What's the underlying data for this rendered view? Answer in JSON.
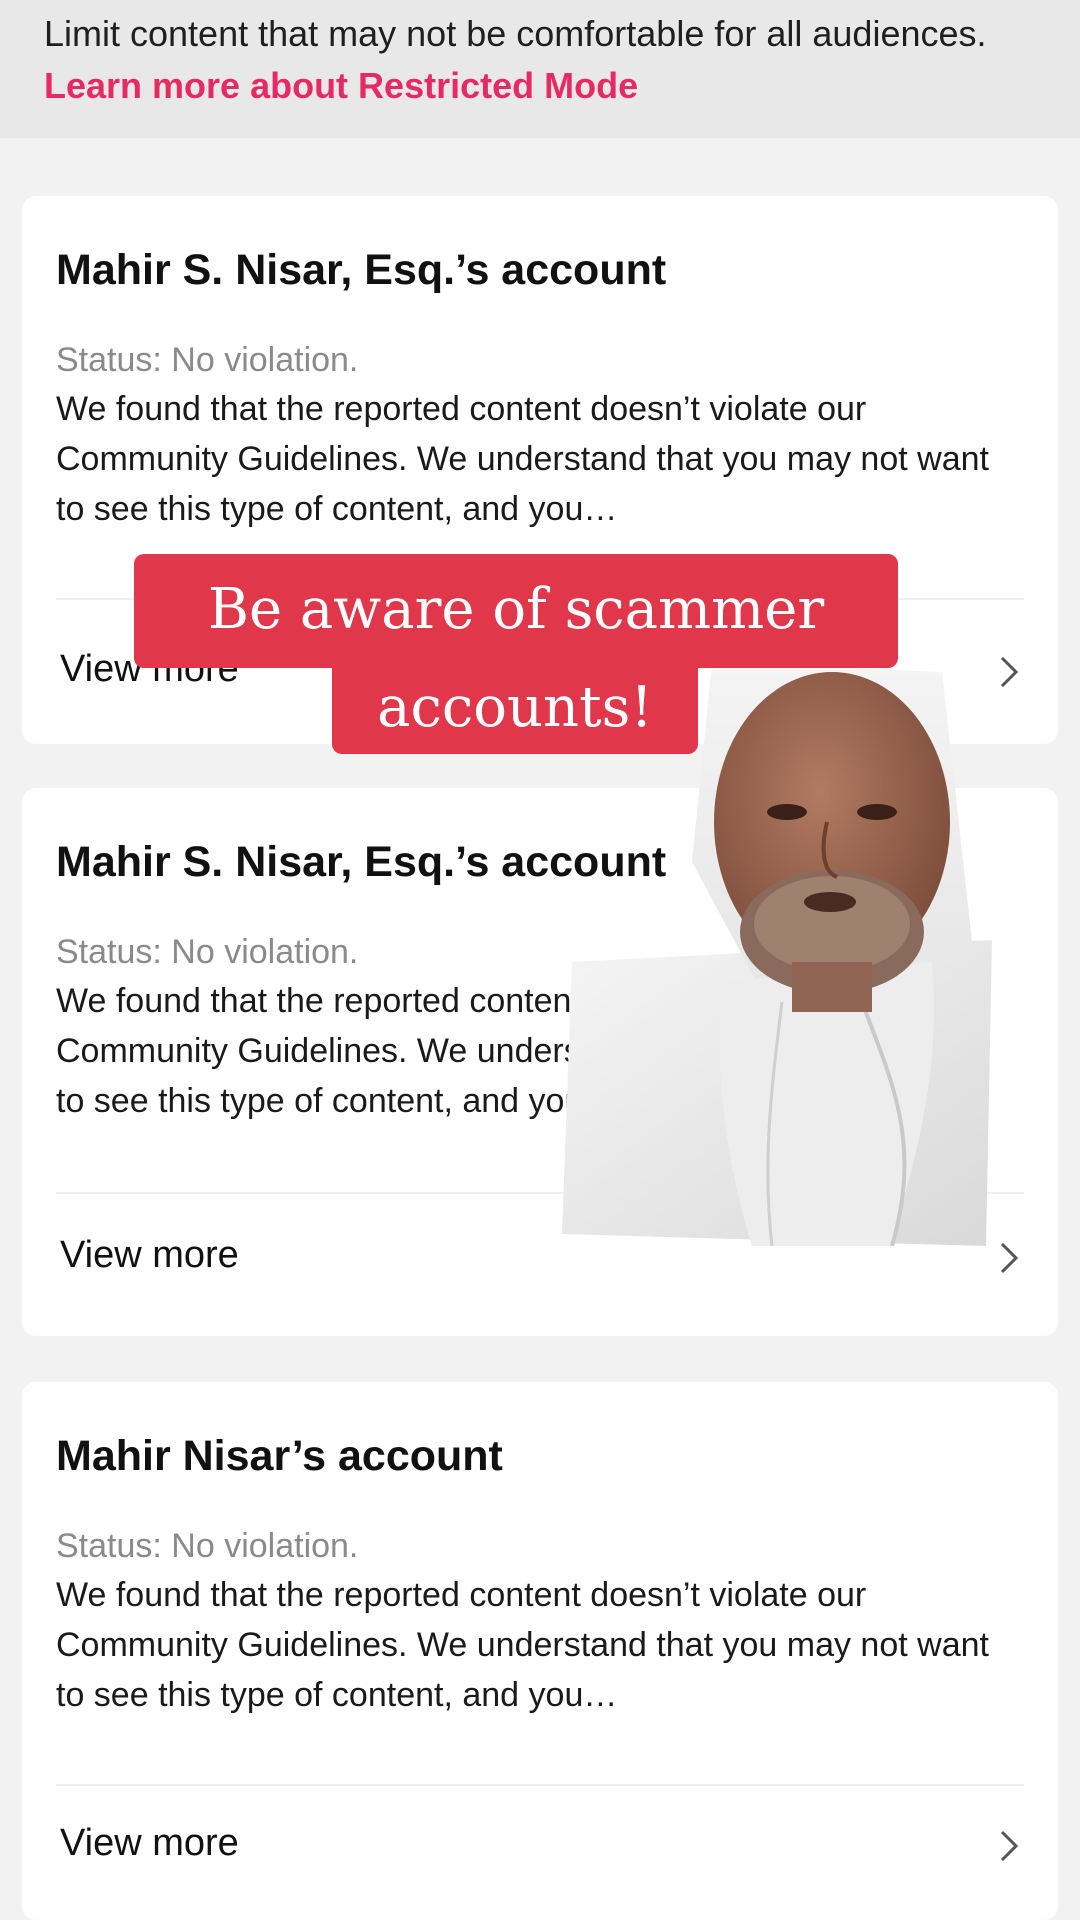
{
  "banner": {
    "text": "Limit content that may not be comfortable for all audiences.",
    "link_label": "Learn more about Restricted Mode"
  },
  "cards": [
    {
      "title": "Mahir S. Nisar, Esq.’s account",
      "status": "Status: No violation.",
      "body": "We found that the reported content doesn’t violate our Community Guidelines. We understand that you may not want to see this type of content, and you…",
      "action_label": "View more"
    },
    {
      "title": "Mahir S. Nisar, Esq.’s account",
      "status": "Status: No violation.",
      "body": "We found that the reported content doesn’t violate our Community Guidelines. We understand that you may not want to see this type of content, and you…",
      "action_label": "View more"
    },
    {
      "title": "Mahir Nisar’s account",
      "status": "Status: No violation.",
      "body": "We found that the reported content doesn’t violate our Community Guidelines. We understand that you may not want to see this type of content, and you…",
      "action_label": "View more"
    }
  ],
  "overlay": {
    "line1": "Be  aware of scammer",
    "line2": "accounts!"
  },
  "icons": {
    "chevron": "chevron-right-icon"
  },
  "colors": {
    "link": "#e52a64",
    "overlay_background": "#e0374a",
    "page_background": "#f2f2f2",
    "banner_background": "#e8e8e8"
  }
}
